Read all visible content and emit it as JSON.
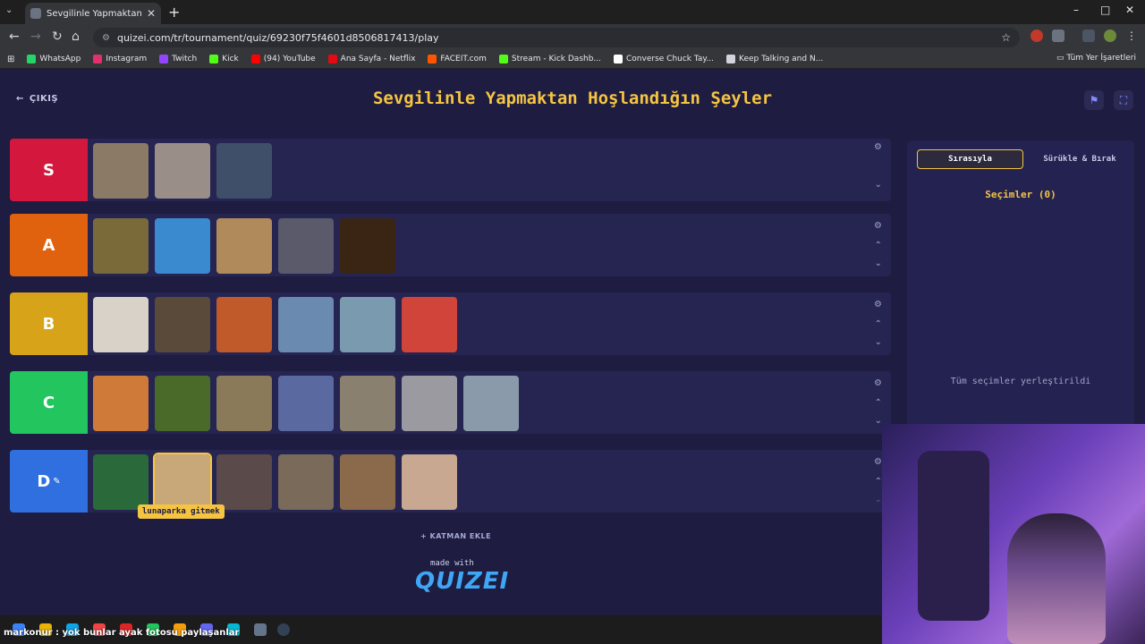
{
  "browser": {
    "tab_title": "Sevgilinle Yapmaktan Hoşlandı",
    "url": "quizei.com/tr/tournament/quiz/69230f75f4601d8506817413/play",
    "bookmarks": [
      {
        "label": "WhatsApp",
        "color": "#25d366"
      },
      {
        "label": "Instagram",
        "color": "#e1306c"
      },
      {
        "label": "Twitch",
        "color": "#9146ff"
      },
      {
        "label": "Kick",
        "color": "#53fc18"
      },
      {
        "label": "(94) YouTube",
        "color": "#ff0000"
      },
      {
        "label": "Ana Sayfa - Netflix",
        "color": "#e50914"
      },
      {
        "label": "FACEIT.com",
        "color": "#ff5500"
      },
      {
        "label": "Stream - Kick Dashb...",
        "color": "#53fc18"
      },
      {
        "label": "Converse Chuck Tay...",
        "color": "#ffffff"
      },
      {
        "label": "Keep Talking and N...",
        "color": "#d1d5db"
      }
    ],
    "all_bookmarks": "Tüm Yer İşaretleri"
  },
  "page": {
    "back_label": "ÇIKIŞ",
    "title": "Sevgilinle Yapmaktan Hoşlandığın Şeyler"
  },
  "tiers": [
    {
      "label": "S",
      "color": "#d4183d",
      "thumbs": [
        "#8a7a66",
        "#9a8f88",
        "#3f4f6a"
      ]
    },
    {
      "label": "A",
      "color": "#e0620f",
      "thumbs": [
        "#7a6a3a",
        "#3a8ad0",
        "#b08a5a",
        "#5a5a6a",
        "#3a2414"
      ]
    },
    {
      "label": "B",
      "color": "#d6a319",
      "thumbs": [
        "#d8d2c8",
        "#5a4a3a",
        "#c05a2a",
        "#6a8ab0",
        "#7a9ab0",
        "#d0443a"
      ]
    },
    {
      "label": "C",
      "color": "#22c55e",
      "thumbs": [
        "#d07a3a",
        "#4a6a2a",
        "#8a7a5a",
        "#5a6aa0",
        "#8a8070",
        "#9a9aa0",
        "#8a9aaa"
      ]
    },
    {
      "label": "D",
      "color": "#2f6fe0",
      "thumbs": [
        "#2a6a3a",
        "#c8a878",
        "#5a4a4a",
        "#7a6a5a",
        "#8a6a4a",
        "#c8a890"
      ]
    }
  ],
  "tooltip": "lunaparka gitmek",
  "add_layer": "KATMAN EKLE",
  "made_with": "made with",
  "logo": "QUIZEI",
  "sidebar": {
    "tab_active": "Sırasıyla",
    "tab_other": "Sürükle & Bırak",
    "title": "Seçimler (0)",
    "empty": "Tüm seçimler yerleştirildi"
  },
  "chat": "markonur : yok bunlar ayak fotosu paylaşanlar"
}
